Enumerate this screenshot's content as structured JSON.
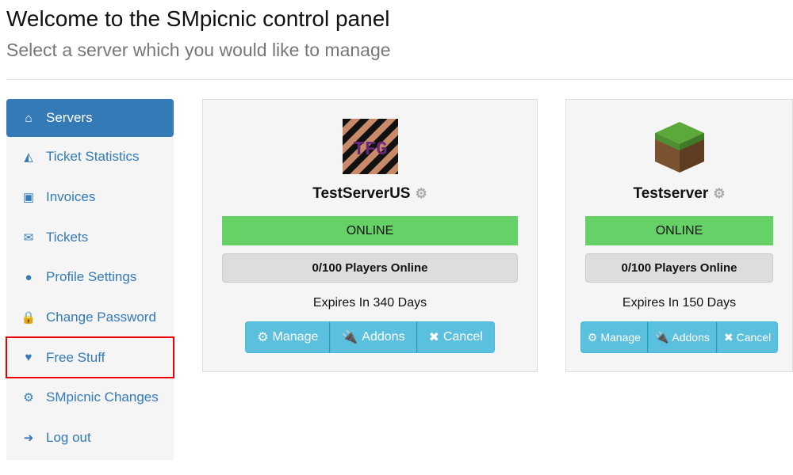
{
  "header": {
    "title": "Welcome to the SMpicnic control panel",
    "subtitle": "Select a server which you would like to manage"
  },
  "sidebar": {
    "items": [
      {
        "label": "Servers",
        "icon": "home-icon",
        "glyph": "⌂",
        "active": true
      },
      {
        "label": "Ticket Statistics",
        "icon": "area-chart-icon",
        "glyph": "◭"
      },
      {
        "label": "Invoices",
        "icon": "money-icon",
        "glyph": "▣"
      },
      {
        "label": "Tickets",
        "icon": "envelope-icon",
        "glyph": "✉"
      },
      {
        "label": "Profile Settings",
        "icon": "user-icon",
        "glyph": "●"
      },
      {
        "label": "Change Password",
        "icon": "lock-icon",
        "glyph": "🔒"
      },
      {
        "label": "Free Stuff",
        "icon": "heart-icon",
        "glyph": "♥",
        "highlighted": true
      },
      {
        "label": "SMpicnic Changes",
        "icon": "cog-icon",
        "glyph": "⚙"
      },
      {
        "label": "Log out",
        "icon": "sign-out-icon",
        "glyph": "➜"
      }
    ]
  },
  "servers": [
    {
      "name": "TestServerUS",
      "logo_text": "TFG",
      "status": "ONLINE",
      "players": "0/100 Players Online",
      "expires": "Expires In 340 Days",
      "buttons": [
        "Manage",
        "Addons",
        "Cancel"
      ]
    },
    {
      "name": "Testserver",
      "status": "ONLINE",
      "players": "0/100 Players Online",
      "expires": "Expires In 150 Days",
      "buttons": [
        "Manage",
        "Addons",
        "Cancel"
      ]
    }
  ],
  "colors": {
    "primary": "#337ab7",
    "online": "#66d166",
    "info": "#5bc0de",
    "highlight": "#e00000"
  }
}
